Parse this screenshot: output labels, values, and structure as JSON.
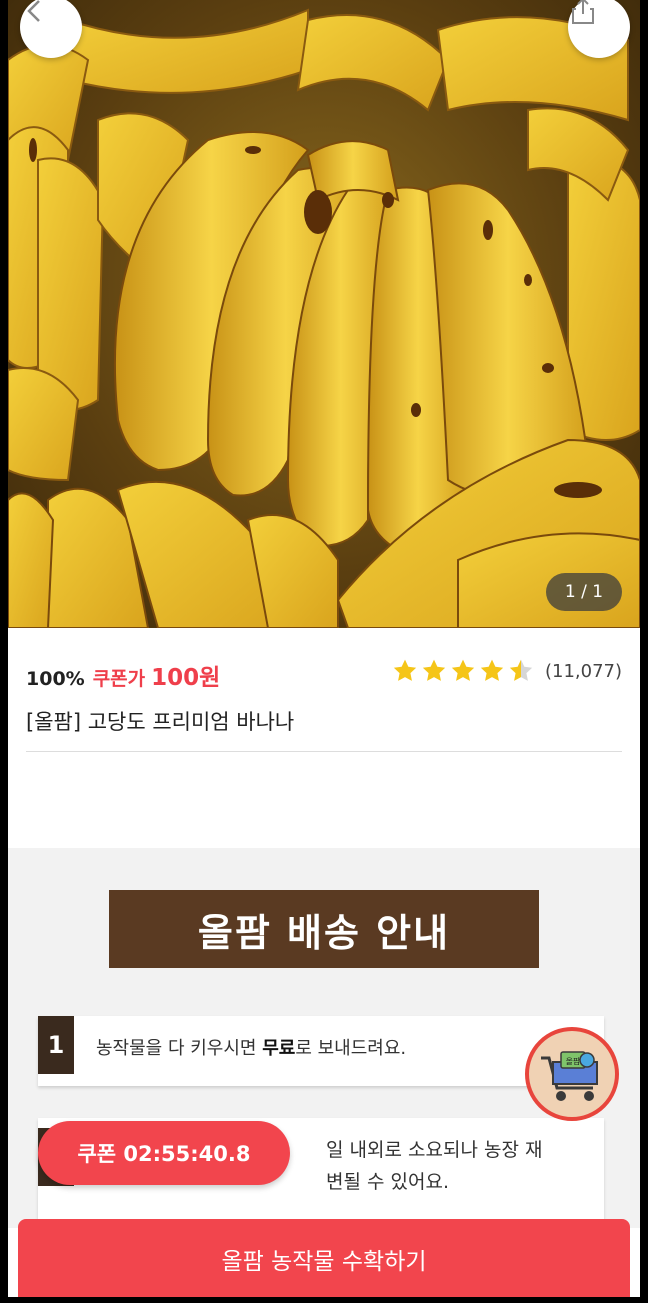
{
  "hero": {
    "page_indicator": "1 / 1",
    "back_icon": "chevron-left-icon",
    "share_icon": "share-icon"
  },
  "product": {
    "percent": "100%",
    "coupon_label": "쿠폰가",
    "coupon_price": "100원",
    "rating": 4.5,
    "review_count": "(11,077)",
    "title": "[올팜] 고당도 프리미엄 바나나"
  },
  "guide": {
    "banner": "올팜 배송 안내",
    "step1_num": "1",
    "step1_text_pre": "농작물을 다 키우시면 ",
    "step1_text_bold": "무료",
    "step1_text_post": "로 보내드려요.",
    "step2_line1": "일 내외로 소요되나 농장 재",
    "step2_line2": "변될 수 있어요."
  },
  "coupon_timer": "쿠폰 02:55:40.8",
  "cart_badge": "올팜",
  "cta": "올팜 농작물 수확하기",
  "colors": {
    "accent": "#f2454d",
    "price_red": "#ef3f4b",
    "banner_brown": "#5a3a22",
    "star": "#f5c518"
  }
}
